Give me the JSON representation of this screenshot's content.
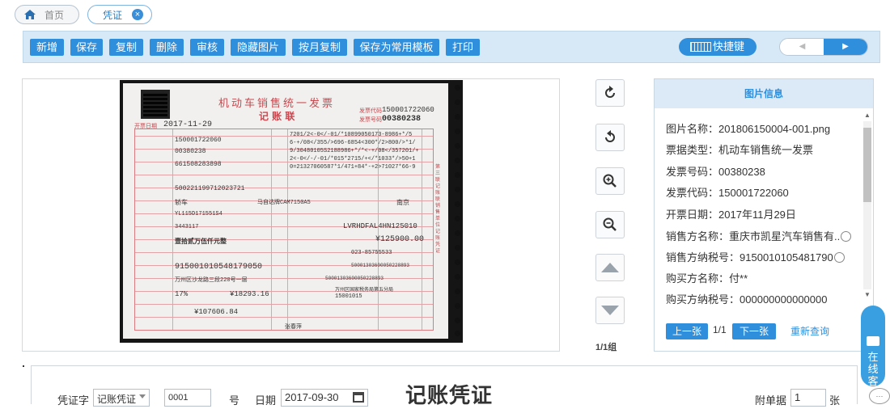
{
  "tabs": [
    {
      "label": "首页"
    },
    {
      "label": "凭证",
      "close": "×"
    }
  ],
  "toolbar": {
    "buttons": [
      "新增",
      "保存",
      "复制",
      "删除",
      "审核",
      "隐藏图片",
      "按月复制",
      "保存为常用模板",
      "打印"
    ],
    "shortcut_label": "快捷键",
    "prev_glyph": "◀",
    "next_glyph": "▶"
  },
  "invoice_image": {
    "title": "机动车销售统一发票",
    "subtitle": "记 账 联",
    "code_label": "发票代码",
    "code": "150001722060",
    "number_label": "发票号码",
    "number": "00380238",
    "date_label": "开票日期",
    "date": "2017-11-29",
    "machine_no": "150001722060",
    "machine_code": "00380238",
    "tax_code": "661508283898",
    "cipher": [
      "7201/2<-0</-01/*10899050173-8986+*/5",
      "6-+/08</355/>696-6854<300*/2>800/>*1/",
      "9/30480105S2188986+*/*<-+/08</357201/+",
      "2<-0</-/-01/*015*2715/+</*1033*/>50+1",
      "0=21327060587*1/471+84*-+2>71027*66-9"
    ],
    "buyer_id": "500221199712023721",
    "vehicle_type": "轿车",
    "brand_model": "马自达牌CAM7150A5",
    "origin": "南京",
    "cert_no": "YL115D171551S4",
    "engine_no": "3443117",
    "vin": "LVRHDFAL4HN125010",
    "total_caps": "壹拾贰万伍仟元整",
    "total_small": "¥125900.00",
    "seller_tax_no": "915001010548179050",
    "phone": "023-85755533",
    "account": "50001303600050228893",
    "address": "万州区沙龙路三段220号一层",
    "bank": "50001303600050228893",
    "tax_rate": "17%",
    "tax_amount": "¥18293.16",
    "tax_office": "万州区国家税务局第五分局",
    "tax_office_code": "15001015",
    "no_tax_price": "¥107606.84",
    "issuer": "张春萍",
    "side_label": "第三联 记账联 销售单位记账凭证"
  },
  "viewer_controls": [
    "rotate-right-icon",
    "rotate-left-icon",
    "zoom-in-icon",
    "zoom-out-icon",
    "up-arrow-icon",
    "down-arrow-icon"
  ],
  "page_count": "1/1组",
  "info_panel": {
    "header": "图片信息",
    "rows": [
      {
        "label": "图片名称",
        "value": "201806150004-001.png"
      },
      {
        "label": "票据类型",
        "value": "机动车销售统一发票"
      },
      {
        "label": "发票号码",
        "value": "00380238"
      },
      {
        "label": "发票代码",
        "value": "150001722060"
      },
      {
        "label": "开票日期",
        "value": "2017年11月29日"
      },
      {
        "label": "销售方名称",
        "value": "重庆市凯星汽车销售有.."
      },
      {
        "label": "销售方纳税号",
        "value": "9150010105481790"
      },
      {
        "label": "购买方名称",
        "value": "付**"
      },
      {
        "label": "购买方纳税号",
        "value": "000000000000000"
      }
    ],
    "prev_label": "上一张",
    "page": "1/1",
    "next_label": "下一张",
    "requery_label": "重新查询"
  },
  "voucher": {
    "word_label": "凭证字",
    "word_value": "记账凭证",
    "number_value": "0001",
    "number_suffix": "号",
    "date_label": "日期",
    "date_value": "2017-09-30",
    "title": "记账凭证",
    "attach_label": "附单据",
    "attach_value": "1",
    "attach_unit": "张"
  },
  "service": {
    "label": "在线客服",
    "chat_glyph": "···"
  }
}
